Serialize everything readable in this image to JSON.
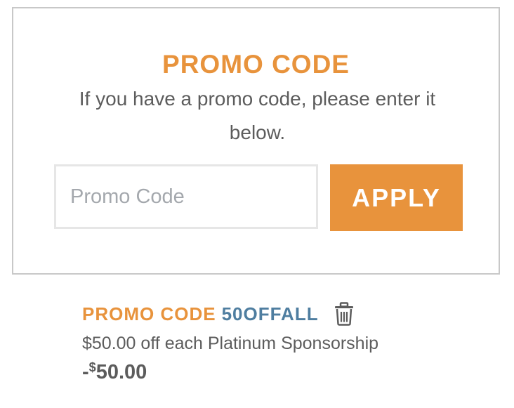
{
  "promo_form": {
    "title": "PROMO CODE",
    "description": "If you have a promo code, please enter it below.",
    "input_placeholder": "Promo Code",
    "input_value": "",
    "apply_label": "APPLY"
  },
  "applied_promo": {
    "label": "PROMO CODE",
    "code": "50OFFALL",
    "remove_icon": "trash-icon",
    "description": "$50.00 off each Platinum Sponsorship",
    "amount_sign": "-",
    "amount_currency": "$",
    "amount_value": "50.00"
  },
  "colors": {
    "accent": "#e8933c",
    "code": "#4f7ea0",
    "text": "#5c5c5c",
    "border": "#c8c8c8",
    "placeholder": "#a4a8ad"
  }
}
